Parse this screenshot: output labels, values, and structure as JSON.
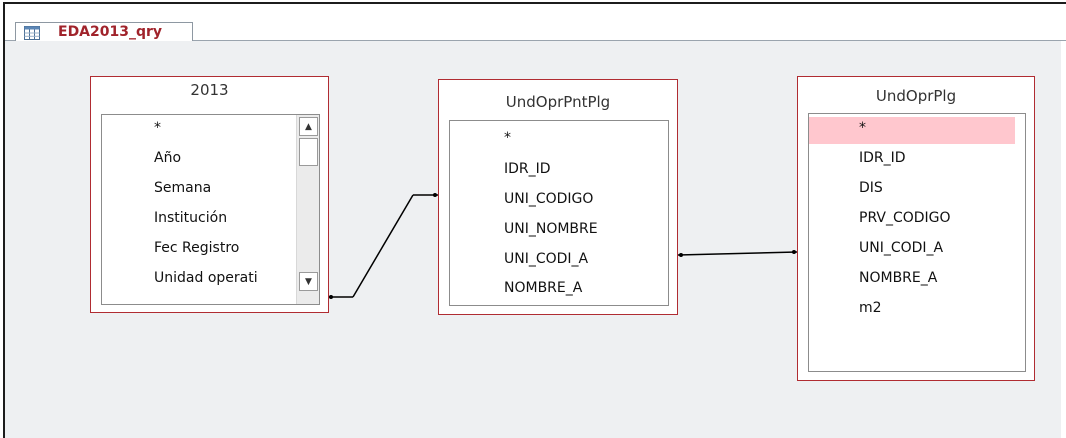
{
  "tab": {
    "label": "EDA2013_qry",
    "icon": "query-icon"
  },
  "tables": [
    {
      "title": "2013",
      "fields": [
        "*",
        "Año",
        "Semana",
        "Institución",
        "Fec Registro",
        "Unidad operati"
      ],
      "has_scrollbar": true
    },
    {
      "title": "UndOprPntPlg",
      "fields": [
        "*",
        "IDR_ID",
        "UNI_CODIGO",
        "UNI_NOMBRE",
        "UNI_CODI_A",
        "NOMBRE_A"
      ]
    },
    {
      "title": "UndOprPlg",
      "fields": [
        "*",
        "IDR_ID",
        "DIS",
        "PRV_CODIGO",
        "UNI_CODI_A",
        "NOMBRE_A",
        "m2"
      ],
      "selected_field": "*"
    }
  ],
  "colors": {
    "tab_label": "#a0232b",
    "table_border": "#b02c32",
    "canvas_bg": "#eef0f2",
    "selected_field_bg": "#ffc7ce"
  }
}
